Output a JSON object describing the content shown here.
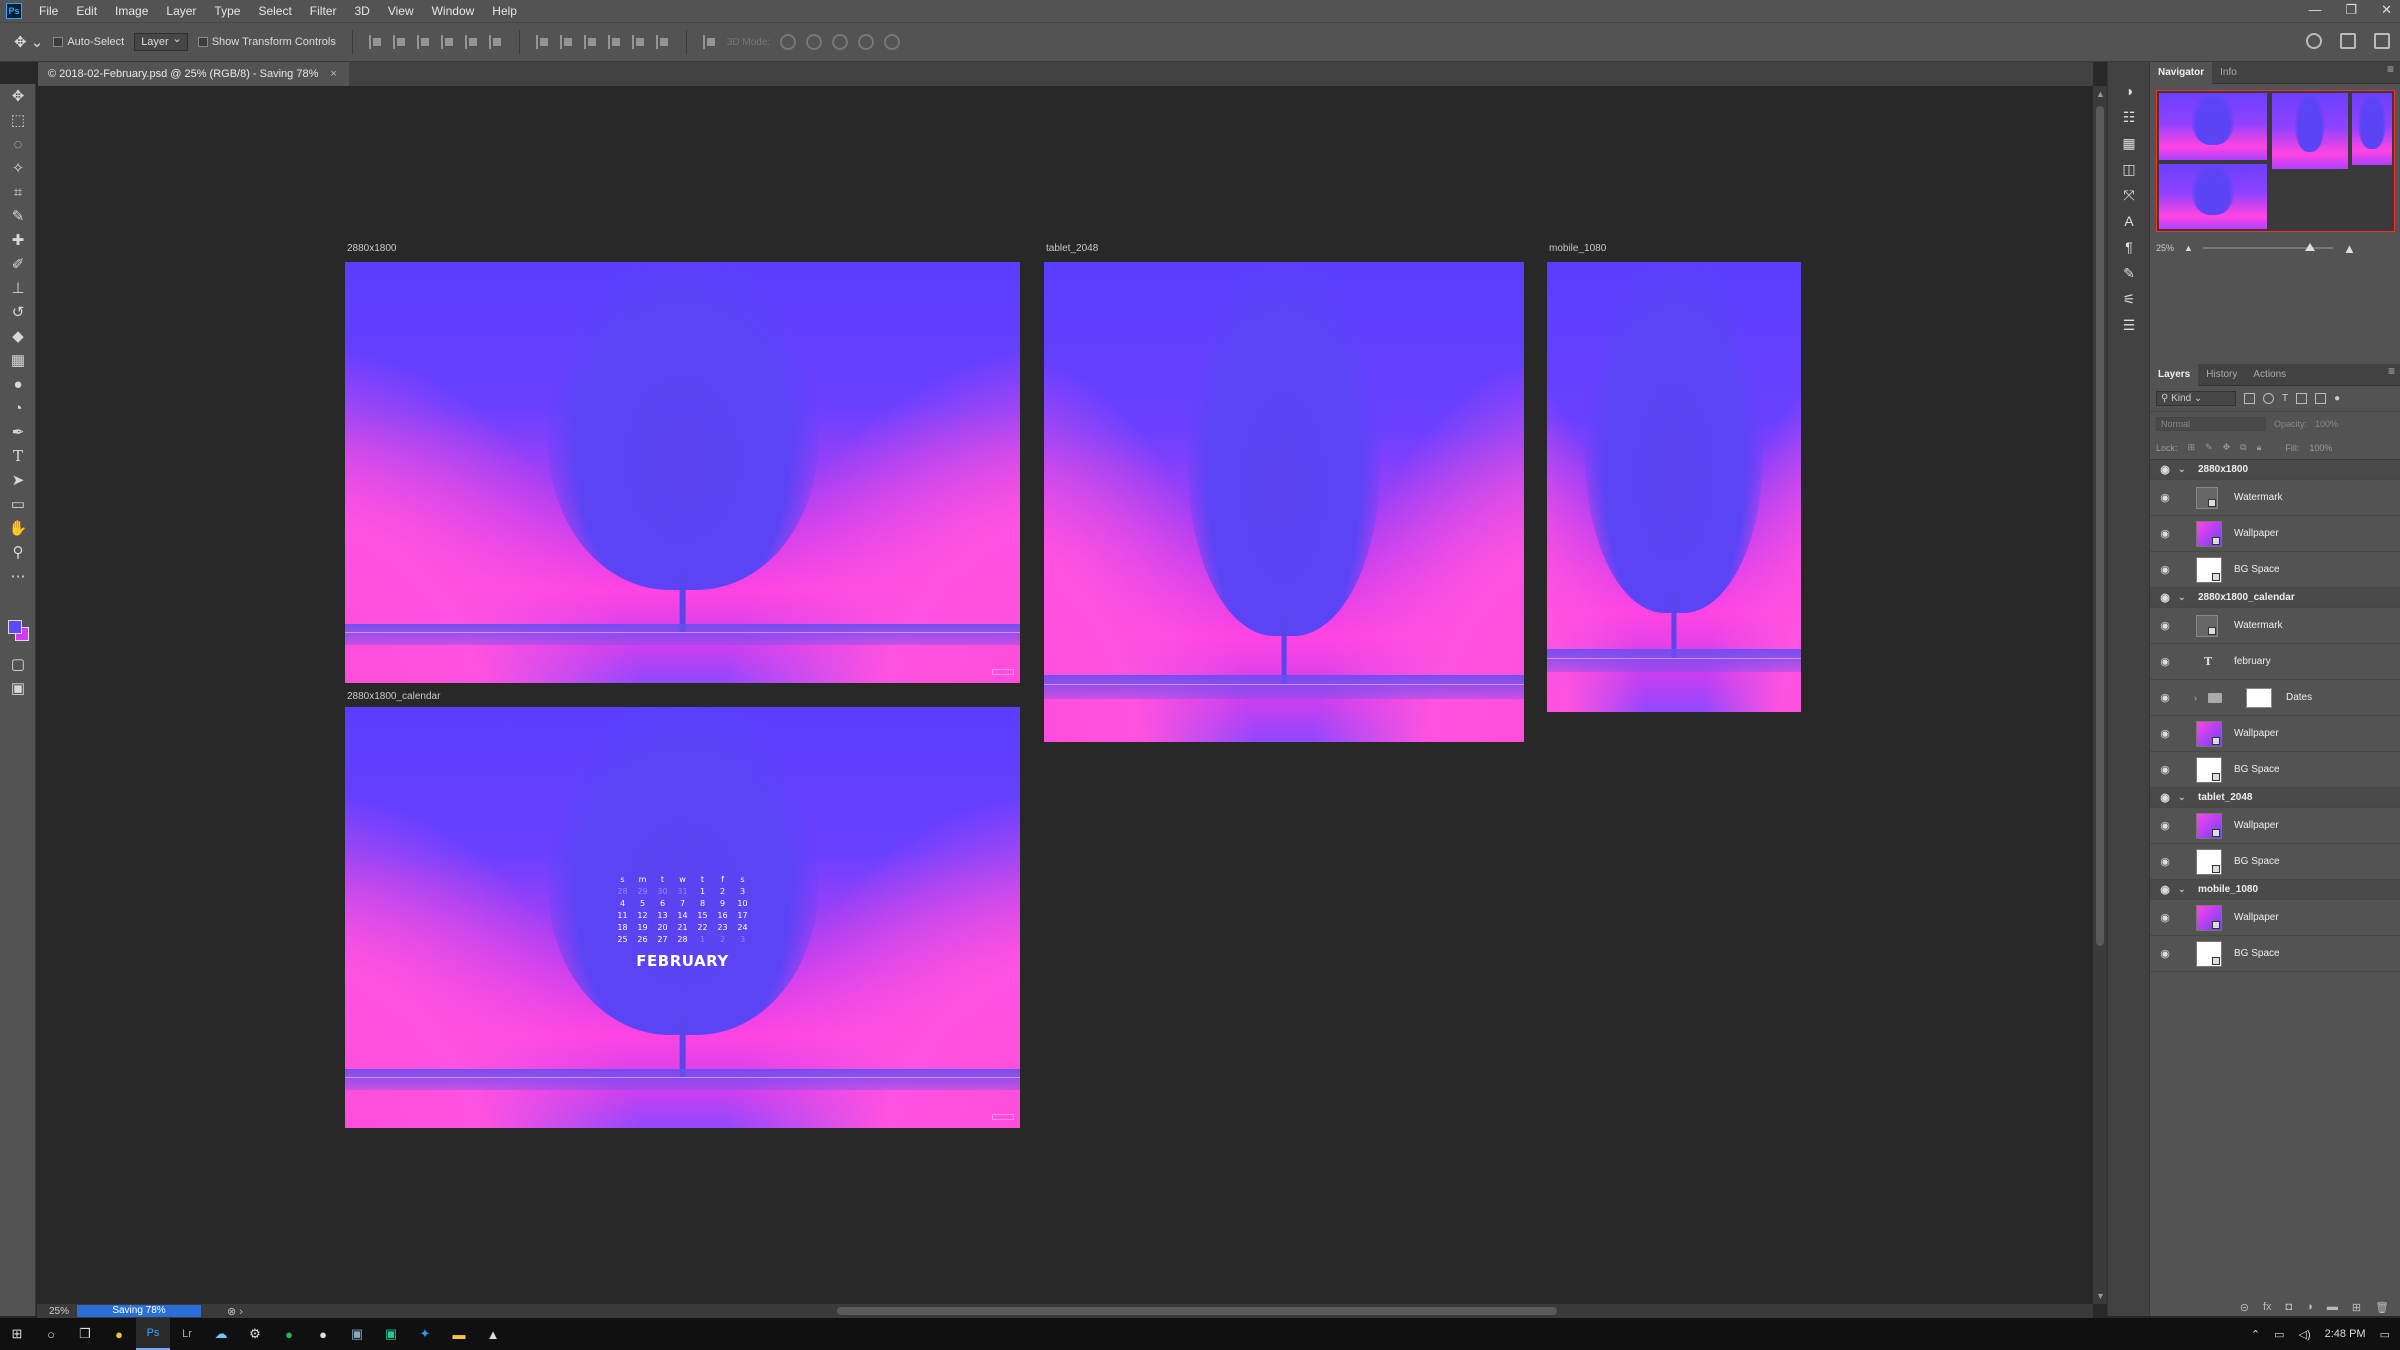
{
  "app": {
    "logo": "Ps",
    "menu": [
      "File",
      "Edit",
      "Image",
      "Layer",
      "Type",
      "Select",
      "Filter",
      "3D",
      "View",
      "Window",
      "Help"
    ],
    "window_controls": [
      "—",
      "❐",
      "✕"
    ]
  },
  "options_bar": {
    "auto_select_label": "Auto-Select",
    "auto_select_target": "Layer",
    "transform_label": "Show Transform Controls",
    "mode_3d_label": "3D Mode:"
  },
  "document_tab": {
    "title": "© 2018-02-February.psd @ 25% (RGB/8) - Saving 78%",
    "close": "×"
  },
  "artboards": [
    {
      "label": "2880x1800",
      "has_calendar": false
    },
    {
      "label": "tablet_2048",
      "has_calendar": false
    },
    {
      "label": "mobile_1080",
      "has_calendar": false
    },
    {
      "label": "2880x1800_calendar",
      "has_calendar": true
    }
  ],
  "calendar": {
    "days": [
      "s",
      "m",
      "t",
      "w",
      "t",
      "f",
      "s"
    ],
    "rows": [
      [
        "28",
        "29",
        "30",
        "31",
        "1",
        "2",
        "3"
      ],
      [
        "4",
        "5",
        "6",
        "7",
        "8",
        "9",
        "10"
      ],
      [
        "11",
        "12",
        "13",
        "14",
        "15",
        "16",
        "17"
      ],
      [
        "18",
        "19",
        "20",
        "21",
        "22",
        "23",
        "24"
      ],
      [
        "25",
        "26",
        "27",
        "28",
        "1",
        "2",
        "3"
      ]
    ],
    "dim_cells": [
      [
        0,
        0
      ],
      [
        0,
        1
      ],
      [
        0,
        2
      ],
      [
        0,
        3
      ],
      [
        4,
        4
      ],
      [
        4,
        5
      ],
      [
        4,
        6
      ]
    ],
    "month": "FEBRUARY"
  },
  "status": {
    "zoom": "25%",
    "progress_label": "Saving 78%",
    "progress_value": 0.78
  },
  "navigator": {
    "tabs": [
      "Navigator",
      "Info"
    ],
    "zoom": "25%"
  },
  "layers": {
    "tabs": [
      "Layers",
      "History",
      "Actions"
    ],
    "kind_label": "Kind",
    "blend_mode": "Normal",
    "opacity_label": "Opacity:",
    "opacity_value": "100%",
    "lock_label": "Lock:",
    "fill_label": "Fill:",
    "fill_value": "100%",
    "rows": [
      {
        "type": "group",
        "name": "2880x1800"
      },
      {
        "type": "smart",
        "name": "Watermark"
      },
      {
        "type": "wallpaper",
        "name": "Wallpaper"
      },
      {
        "type": "bg",
        "name": "BG Space"
      },
      {
        "type": "group",
        "name": "2880x1800_calendar"
      },
      {
        "type": "smart",
        "name": "Watermark"
      },
      {
        "type": "text",
        "name": "february"
      },
      {
        "type": "folder",
        "name": "Dates"
      },
      {
        "type": "wallpaper",
        "name": "Wallpaper"
      },
      {
        "type": "bg",
        "name": "BG Space"
      },
      {
        "type": "group",
        "name": "tablet_2048"
      },
      {
        "type": "wallpaper",
        "name": "Wallpaper"
      },
      {
        "type": "bg",
        "name": "BG Space"
      },
      {
        "type": "group",
        "name": "mobile_1080"
      },
      {
        "type": "wallpaper",
        "name": "Wallpaper"
      },
      {
        "type": "bg",
        "name": "BG Space"
      }
    ]
  },
  "taskbar": {
    "time": "2:48 PM",
    "apps": [
      "start-icon",
      "cortana-icon",
      "task-view-icon",
      "chrome-icon",
      "photoshop-icon",
      "lightroom-icon",
      "onedrive-icon",
      "steam-icon",
      "spotify-icon",
      "app-icon",
      "browser-icon",
      "green-app-icon",
      "twitter-icon",
      "file-explorer-icon",
      "photos-icon"
    ]
  }
}
